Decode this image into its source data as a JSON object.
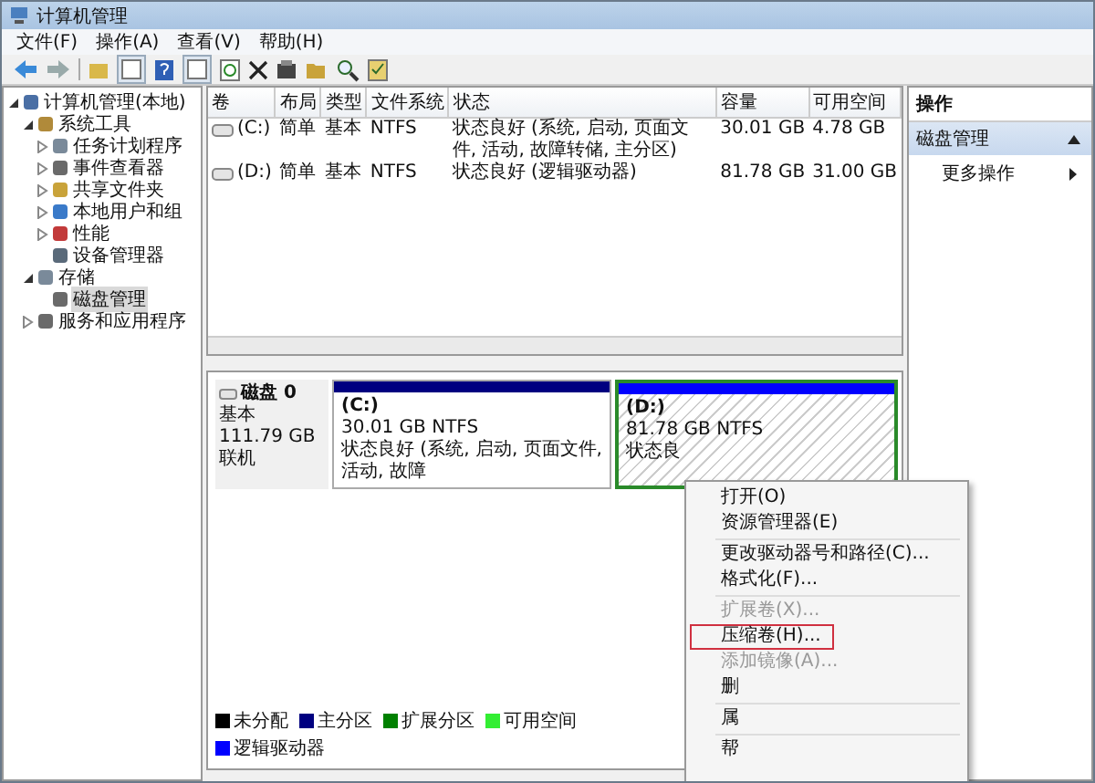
{
  "window": {
    "title": "计算机管理"
  },
  "menu_bar": [
    "文件(F)",
    "操作(A)",
    "查看(V)",
    "帮助(H)"
  ],
  "tree": [
    {
      "label": "计算机管理(本地)",
      "selected": false,
      "expanded": true,
      "children": [
        {
          "label": "系统工具",
          "selected": false,
          "expanded": true,
          "children": [
            {
              "label": "任务计划程序",
              "selected": false,
              "expanded": false
            },
            {
              "label": "事件查看器",
              "selected": false,
              "expanded": false
            },
            {
              "label": "共享文件夹",
              "selected": false,
              "expanded": false
            },
            {
              "label": "本地用户和组",
              "selected": false,
              "expanded": false
            },
            {
              "label": "性能",
              "selected": false,
              "expanded": false
            },
            {
              "label": "设备管理器",
              "selected": false
            }
          ]
        },
        {
          "label": "存储",
          "selected": false,
          "expanded": true,
          "children": [
            {
              "label": "磁盘管理",
              "selected": true
            }
          ]
        },
        {
          "label": "服务和应用程序",
          "selected": false,
          "expanded": false
        }
      ]
    }
  ],
  "volumes": {
    "columns": [
      "卷",
      "布局",
      "类型",
      "文件系统",
      "状态",
      "容量",
      "可用空间"
    ],
    "rows": [
      [
        "(C:)",
        "简单",
        "基本",
        "NTFS",
        "状态良好 (系统, 启动, 页面文件, 活动, 故障转储, 主分区)",
        "30.01 GB",
        "4.78 GB"
      ],
      [
        "(D:)",
        "简单",
        "基本",
        "NTFS",
        "状态良好 (逻辑驱动器)",
        "81.78 GB",
        "31.00 GB"
      ]
    ]
  },
  "disk": {
    "name": "磁盘 0",
    "type": "基本",
    "size": "111.79 GB",
    "status": "联机",
    "partitions": [
      {
        "kind": "primary",
        "label": "(C:)",
        "size": "30.01 GB NTFS",
        "status": "状态良好 (系统, 启动, 页面文件, 活动, 故障",
        "selected": false
      },
      {
        "kind": "logical",
        "label": "(D:)",
        "size": "81.78 GB NTFS",
        "status": "状态良",
        "selected": true
      }
    ]
  },
  "legend": [
    {
      "label": "未分配",
      "color": "#000000"
    },
    {
      "label": "主分区",
      "color": "#000080"
    },
    {
      "label": "扩展分区",
      "color": "#008000"
    },
    {
      "label": "可用空间",
      "color": "#33ee33"
    },
    {
      "label": "逻辑驱动器",
      "color": "#0000ff"
    }
  ],
  "actions": {
    "title": "操作",
    "section": {
      "label": "磁盘管理",
      "expanded": true
    },
    "items": [
      "更多操作"
    ]
  },
  "context_menu": [
    {
      "kind": "item",
      "label": "打开(O)",
      "disabled": false,
      "highlighted": false
    },
    {
      "kind": "item",
      "label": "资源管理器(E)",
      "disabled": false,
      "highlighted": false
    },
    {
      "kind": "separator"
    },
    {
      "kind": "item",
      "label": "更改驱动器号和路径(C)...",
      "disabled": false,
      "highlighted": false
    },
    {
      "kind": "item",
      "label": "格式化(F)...",
      "disabled": false,
      "highlighted": false
    },
    {
      "kind": "separator"
    },
    {
      "kind": "item",
      "label": "扩展卷(X)...",
      "disabled": true,
      "highlighted": false
    },
    {
      "kind": "item",
      "label": "压缩卷(H)...",
      "disabled": false,
      "highlighted": true
    },
    {
      "kind": "item",
      "label": "添加镜像(A)...",
      "disabled": true,
      "highlighted": false
    },
    {
      "kind": "item",
      "label": "删",
      "disabled": false,
      "highlighted": false
    },
    {
      "kind": "separator"
    },
    {
      "kind": "item",
      "label": "属",
      "disabled": false,
      "highlighted": false
    },
    {
      "kind": "separator"
    },
    {
      "kind": "item",
      "label": "帮",
      "disabled": false,
      "highlighted": false
    }
  ]
}
